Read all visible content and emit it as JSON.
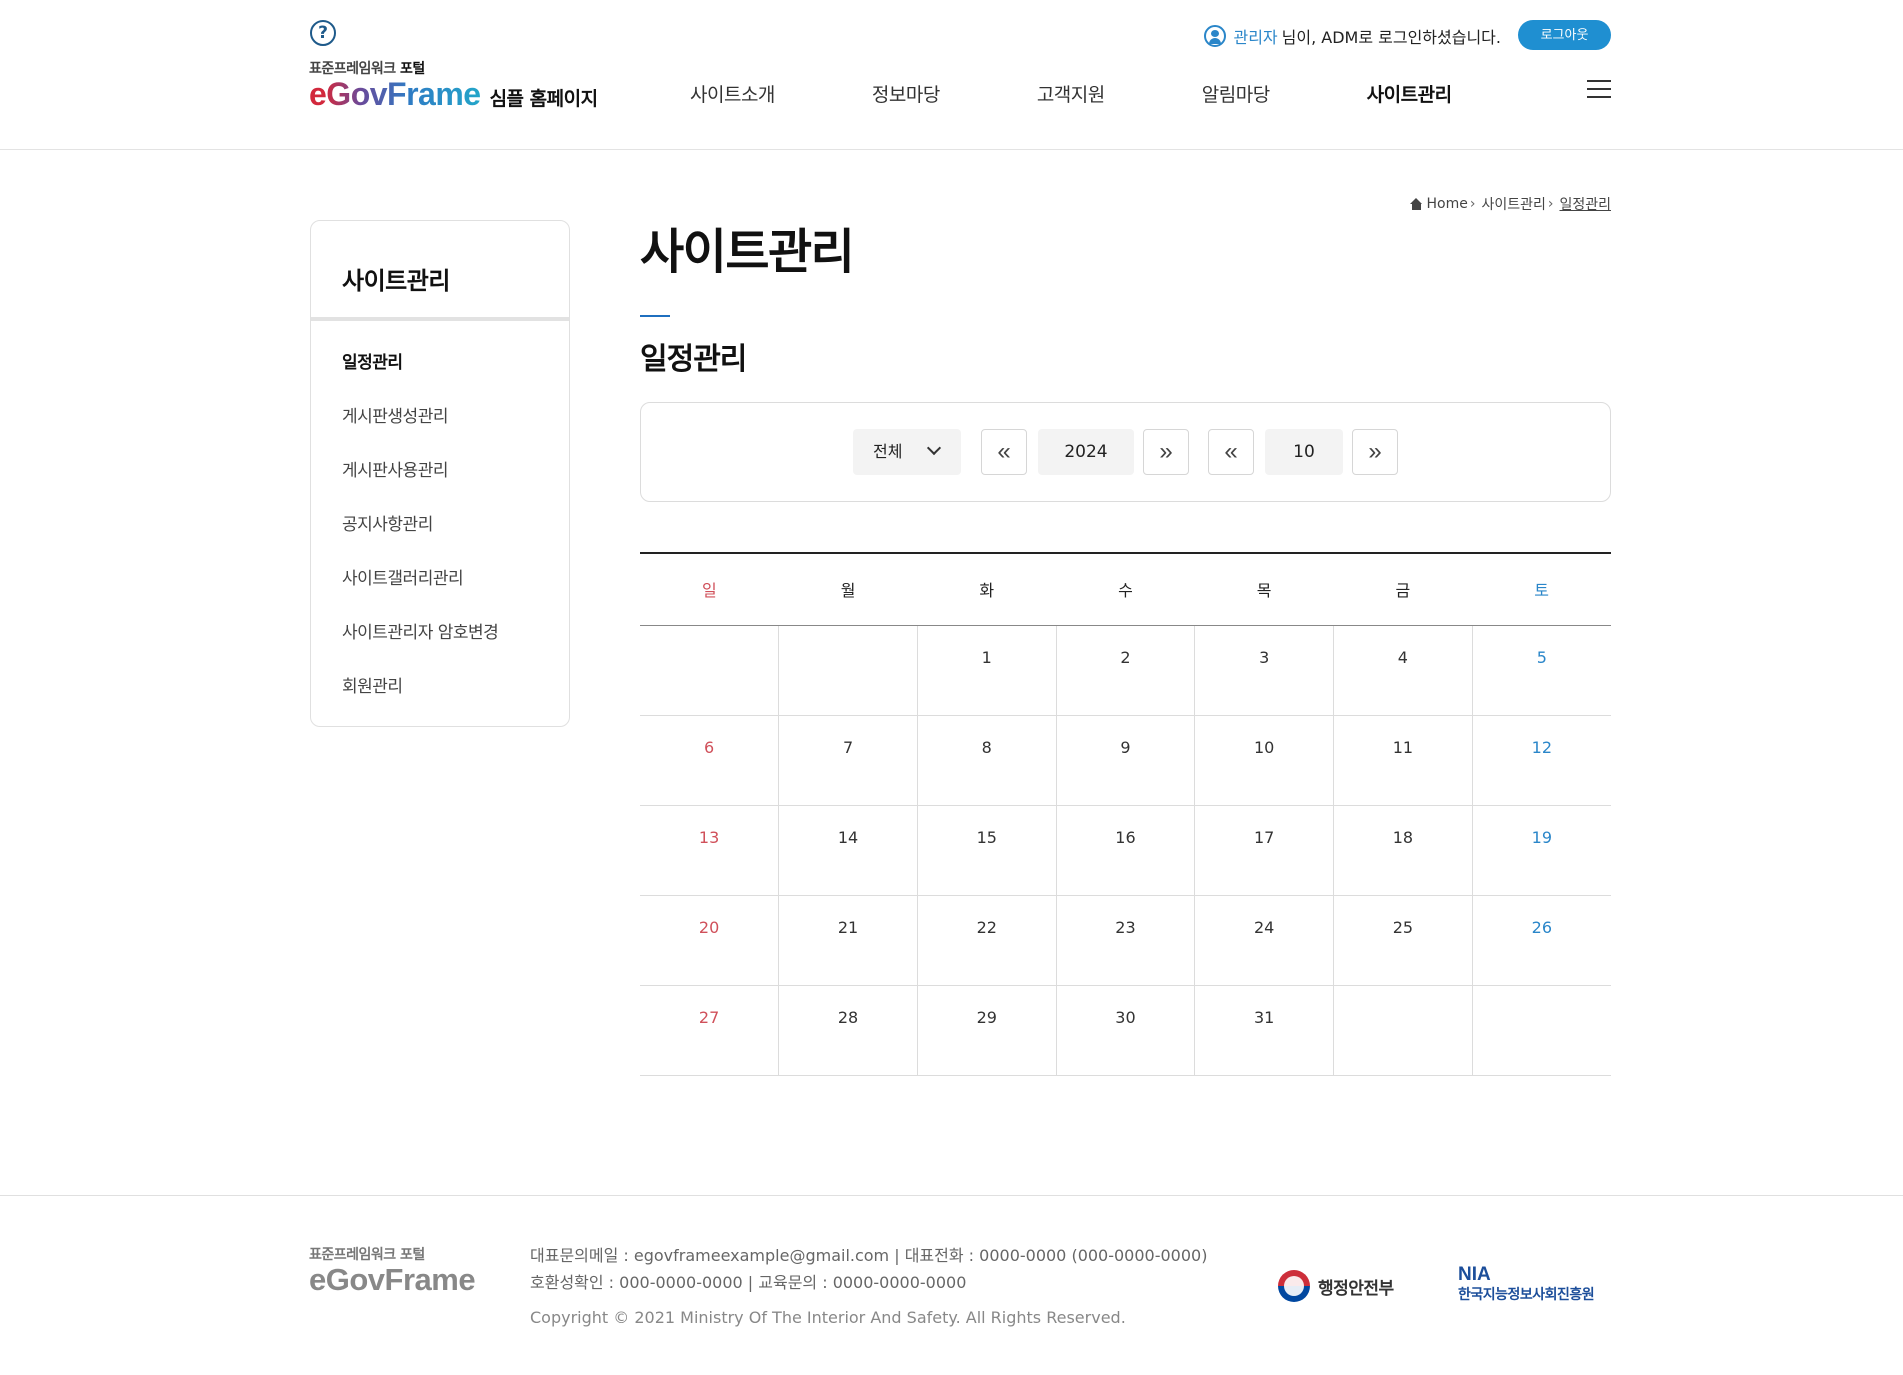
{
  "header": {
    "help_label": "?",
    "logo_sub_prefix": "표준프레임워크 ",
    "logo_sub_strong": "포털",
    "logo_main": "eGovFrame",
    "logo_text": "심플 홈페이지",
    "user_name": "관리자",
    "user_suffix": " 님이, ADM로 로그인하셨습니다.",
    "logout_label": "로그아웃",
    "nav": [
      "사이트소개",
      "정보마당",
      "고객지원",
      "알림마당",
      "사이트관리"
    ],
    "nav_active_index": 4
  },
  "breadcrumb": {
    "home": "Home",
    "level1": "사이트관리",
    "current": "일정관리"
  },
  "sidebar": {
    "title": "사이트관리",
    "items": [
      {
        "label": "일정관리",
        "active": true
      },
      {
        "label": "게시판생성관리",
        "active": false
      },
      {
        "label": "게시판사용관리",
        "active": false
      },
      {
        "label": "공지사항관리",
        "active": false
      },
      {
        "label": "사이트갤러리관리",
        "active": false
      },
      {
        "label": "사이트관리자 암호변경",
        "active": false
      },
      {
        "label": "회원관리",
        "active": false
      }
    ]
  },
  "main": {
    "page_title": "사이트관리",
    "sub_title": "일정관리"
  },
  "search": {
    "category_selected": "전체",
    "year": "2024",
    "month": "10",
    "prev_icon": "«",
    "next_icon": "»"
  },
  "calendar": {
    "weekdays": [
      "일",
      "월",
      "화",
      "수",
      "목",
      "금",
      "토"
    ],
    "weeks": [
      [
        "",
        "",
        "1",
        "2",
        "3",
        "4",
        "5"
      ],
      [
        "6",
        "7",
        "8",
        "9",
        "10",
        "11",
        "12"
      ],
      [
        "13",
        "14",
        "15",
        "16",
        "17",
        "18",
        "19"
      ],
      [
        "20",
        "21",
        "22",
        "23",
        "24",
        "25",
        "26"
      ],
      [
        "27",
        "28",
        "29",
        "30",
        "31",
        "",
        ""
      ]
    ]
  },
  "footer": {
    "logo_sub": "표준프레임워크 포털",
    "logo_main": "eGovFrame",
    "info_line1": "대표문의메일 : egovframeexample@gmail.com | 대표전화 : 0000-0000 (000-0000-0000)",
    "info_line2": "호환성확인 : 000-0000-0000 | 교육문의 : 0000-0000-0000",
    "copyright": "Copyright © 2021 Ministry Of The Interior And Safety. All Rights Reserved.",
    "gov_name": "행정안전부",
    "nia_main": "NIA",
    "nia_sub": "한국지능정보사회진흥원"
  },
  "colors": {
    "accent": "#1f8fd1",
    "sunday": "#d0505a",
    "saturday": "#2a86c9"
  }
}
